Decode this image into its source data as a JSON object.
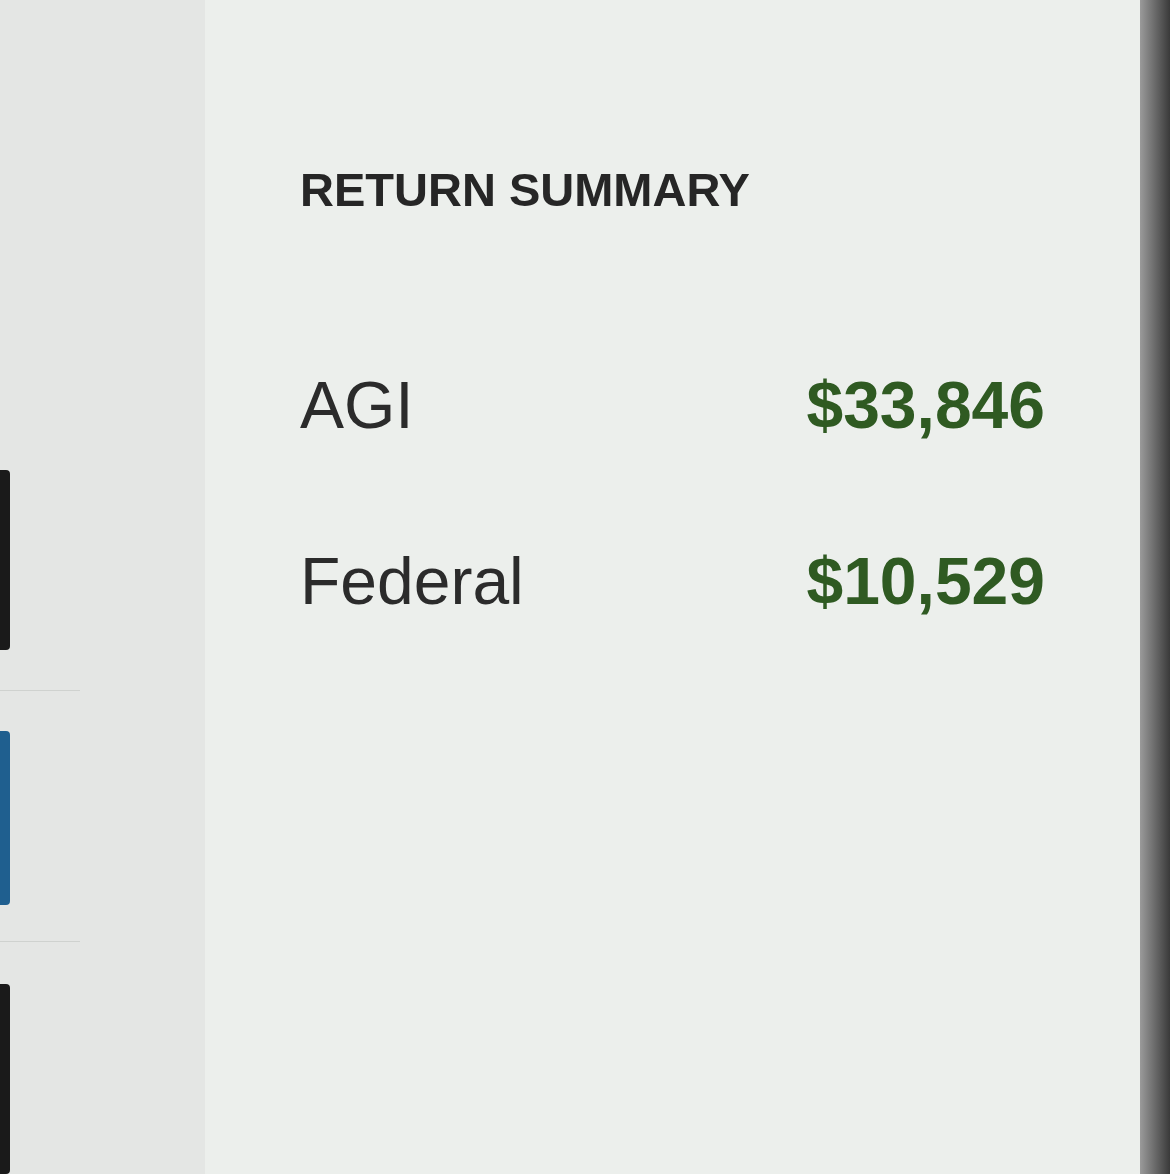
{
  "title": "RETURN SUMMARY",
  "rows": [
    {
      "label": "AGI",
      "amount": "$33,846"
    },
    {
      "label": "Federal",
      "amount": "$10,529"
    }
  ]
}
